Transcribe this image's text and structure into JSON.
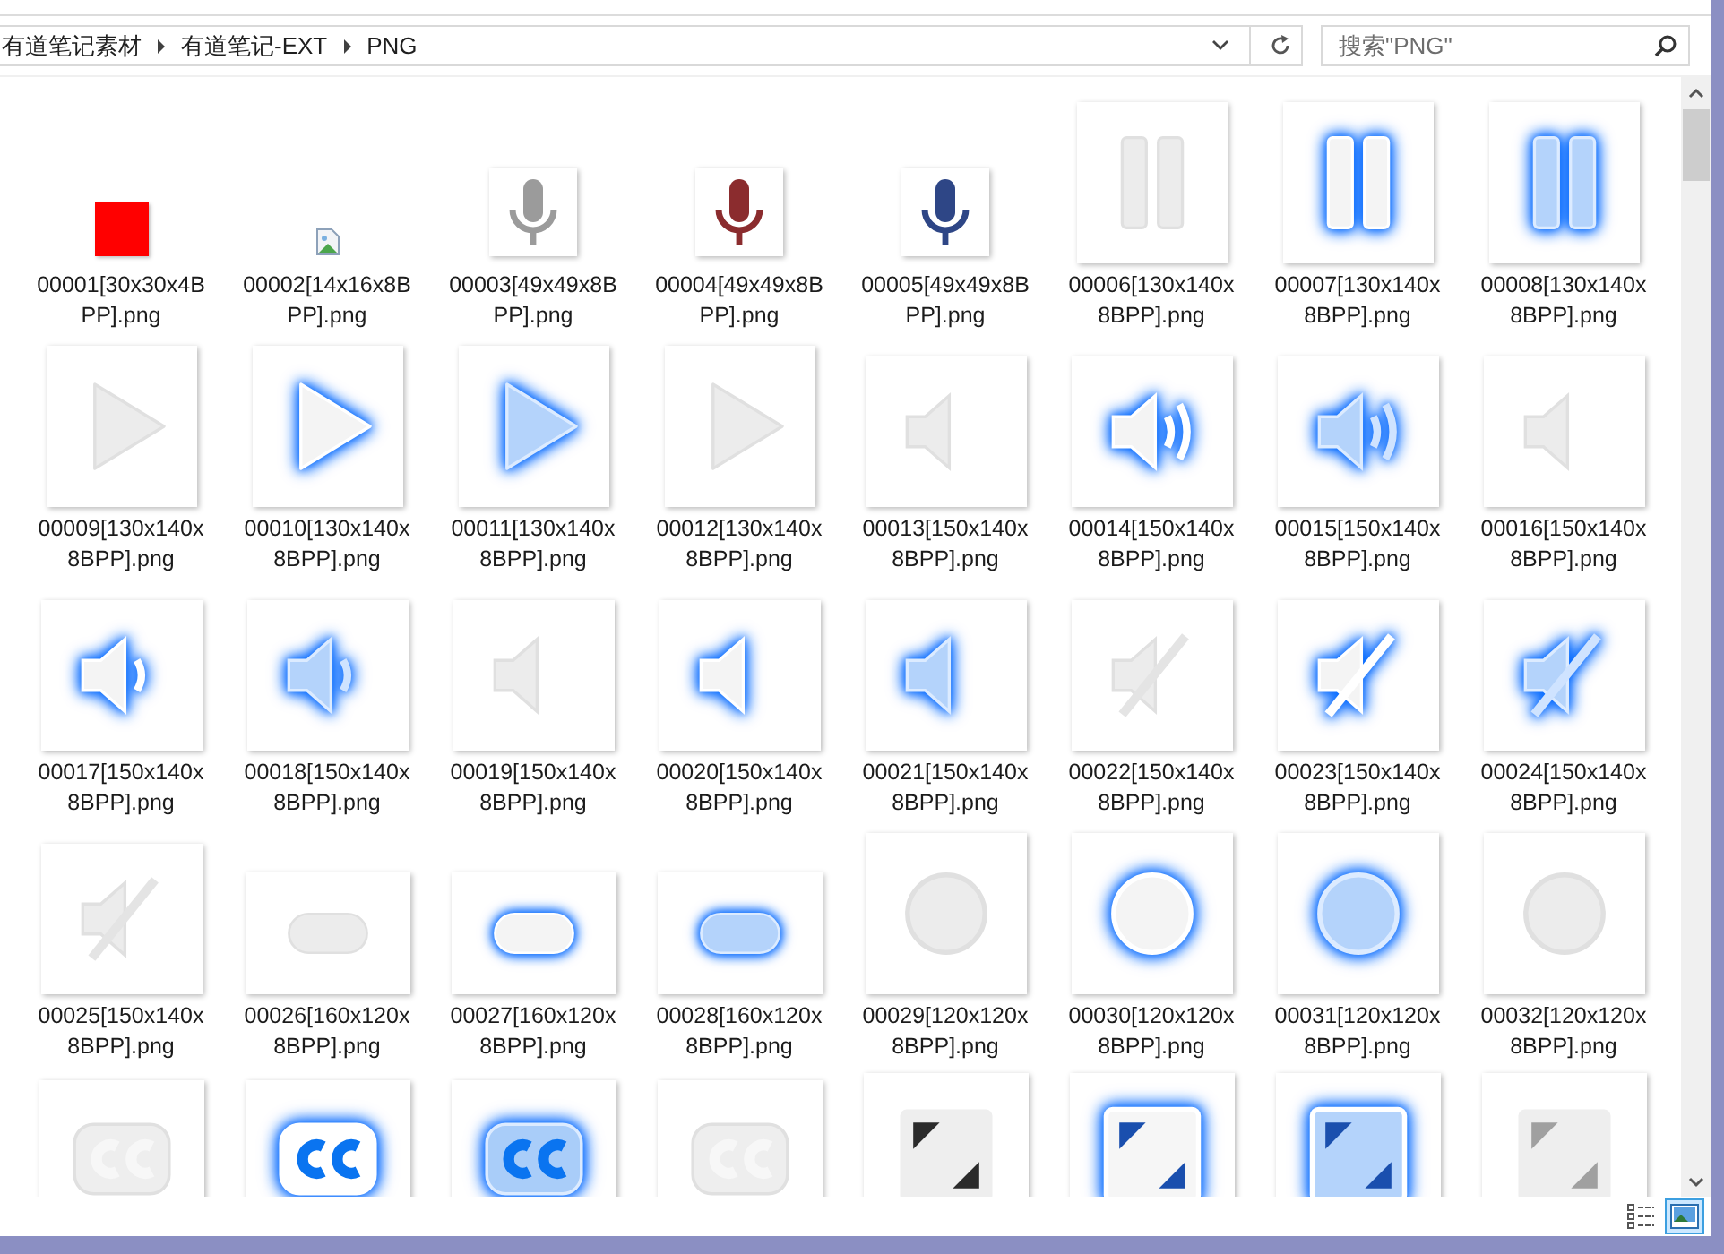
{
  "address_bar": {
    "path": [
      "有道笔记素材",
      "有道笔记-EXT",
      "PNG"
    ]
  },
  "search": {
    "placeholder": "搜索\"PNG\""
  },
  "files": [
    {
      "name": "00001[30x30x4BPP].png",
      "kind": "square"
    },
    {
      "name": "00002[14x16x8BPP].png",
      "kind": "broken"
    },
    {
      "name": "00003[49x49x8BPP].png",
      "kind": "mic",
      "color": "#9b9b9b"
    },
    {
      "name": "00004[49x49x8BPP].png",
      "kind": "mic",
      "color": "#8b2c2e"
    },
    {
      "name": "00005[49x49x8BPP].png",
      "kind": "mic",
      "color": "#2e4686"
    },
    {
      "name": "00006[130x140x8BPP].png",
      "kind": "pausedim"
    },
    {
      "name": "00007[130x140x8BPP].png",
      "kind": "pauseglow"
    },
    {
      "name": "00008[130x140x8BPP].png",
      "kind": "pausesoft"
    },
    {
      "name": "00009[130x140x8BPP].png",
      "kind": "playdim"
    },
    {
      "name": "00010[130x140x8BPP].png",
      "kind": "playglow"
    },
    {
      "name": "00011[130x140x8BPP].png",
      "kind": "playsoft"
    },
    {
      "name": "00012[130x140x8BPP].png",
      "kind": "playdim"
    },
    {
      "name": "00013[150x140x8BPP].png",
      "kind": "speakerdim"
    },
    {
      "name": "00014[150x140x8BPP].png",
      "kind": "loudglow"
    },
    {
      "name": "00015[150x140x8BPP].png",
      "kind": "loudsoft"
    },
    {
      "name": "00016[150x140x8BPP].png",
      "kind": "speakerdim"
    },
    {
      "name": "00017[150x140x8BPP].png",
      "kind": "mediumglow"
    },
    {
      "name": "00018[150x140x8BPP].png",
      "kind": "mediumsoft"
    },
    {
      "name": "00019[150x140x8BPP].png",
      "kind": "speakerdim"
    },
    {
      "name": "00020[150x140x8BPP].png",
      "kind": "speakerglow"
    },
    {
      "name": "00021[150x140x8BPP].png",
      "kind": "speakersoft"
    },
    {
      "name": "00022[150x140x8BPP].png",
      "kind": "muteddim"
    },
    {
      "name": "00023[150x140x8BPP].png",
      "kind": "mutedglow"
    },
    {
      "name": "00024[150x140x8BPP].png",
      "kind": "mutedsoft"
    },
    {
      "name": "00025[150x140x8BPP].png",
      "kind": "muteddim"
    },
    {
      "name": "00026[160x120x8BPP].png",
      "kind": "pilldim"
    },
    {
      "name": "00027[160x120x8BPP].png",
      "kind": "pillglow"
    },
    {
      "name": "00028[160x120x8BPP].png",
      "kind": "pillsoft"
    },
    {
      "name": "00029[120x120x8BPP].png",
      "kind": "circledim"
    },
    {
      "name": "00030[120x120x8BPP].png",
      "kind": "circleglow"
    },
    {
      "name": "00031[120x120x8BPP].png",
      "kind": "circlesoft"
    },
    {
      "name": "00032[120x120x8BPP].png",
      "kind": "circledim"
    },
    {
      "kind": "ccdim"
    },
    {
      "kind": "ccglow"
    },
    {
      "kind": "ccsoft"
    },
    {
      "kind": "ccdim"
    },
    {
      "kind": "resizedark"
    },
    {
      "kind": "resizeglow"
    },
    {
      "kind": "resizesoft"
    },
    {
      "kind": "resizegray"
    }
  ],
  "view_buttons": [
    {
      "kind": "details",
      "selected": false
    },
    {
      "kind": "thumbnails",
      "selected": true
    }
  ]
}
